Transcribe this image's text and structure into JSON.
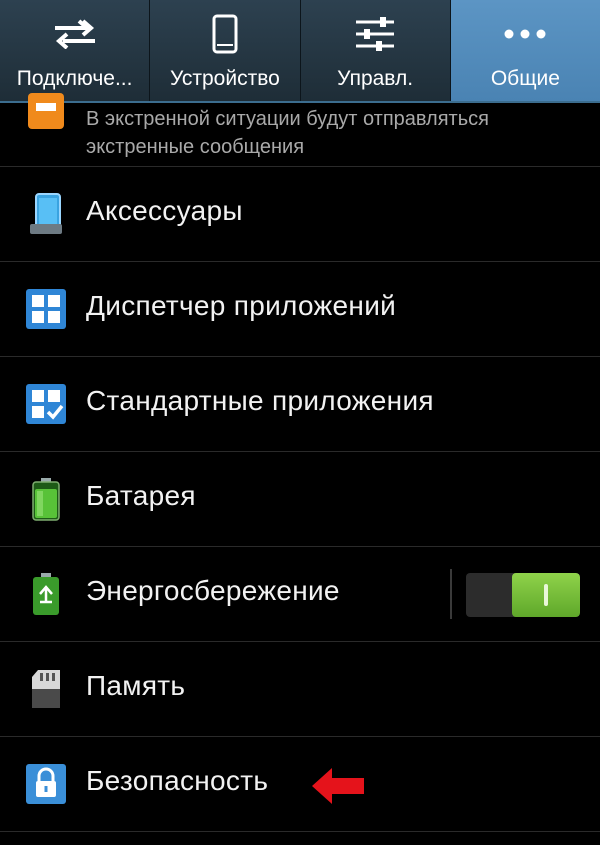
{
  "tabs": [
    {
      "label": "Подключе...",
      "icon": "transfer-arrows-icon",
      "active": false
    },
    {
      "label": "Устройство",
      "icon": "phone-icon",
      "active": false
    },
    {
      "label": "Управл.",
      "icon": "sliders-icon",
      "active": false
    },
    {
      "label": "Общие",
      "icon": "more-dots-icon",
      "active": true
    }
  ],
  "emergency": {
    "desc_line1": "В экстренной ситуации будут отправляться",
    "desc_line2": "экстренные сообщения"
  },
  "items": [
    {
      "label": "Аксессуары",
      "icon": "accessory-phone-icon"
    },
    {
      "label": "Диспетчер приложений",
      "icon": "app-grid-icon"
    },
    {
      "label": "Стандартные приложения",
      "icon": "default-apps-icon"
    },
    {
      "label": "Батарея",
      "icon": "battery-icon"
    },
    {
      "label": "Энергосбережение",
      "icon": "power-saving-icon",
      "toggle": "on"
    },
    {
      "label": "Память",
      "icon": "sd-card-icon"
    },
    {
      "label": "Безопасность",
      "icon": "lock-icon"
    }
  ],
  "colors": {
    "active_tab": "#4a83b3",
    "toggle_on": "#6cb832",
    "arrow": "#e5131b"
  }
}
